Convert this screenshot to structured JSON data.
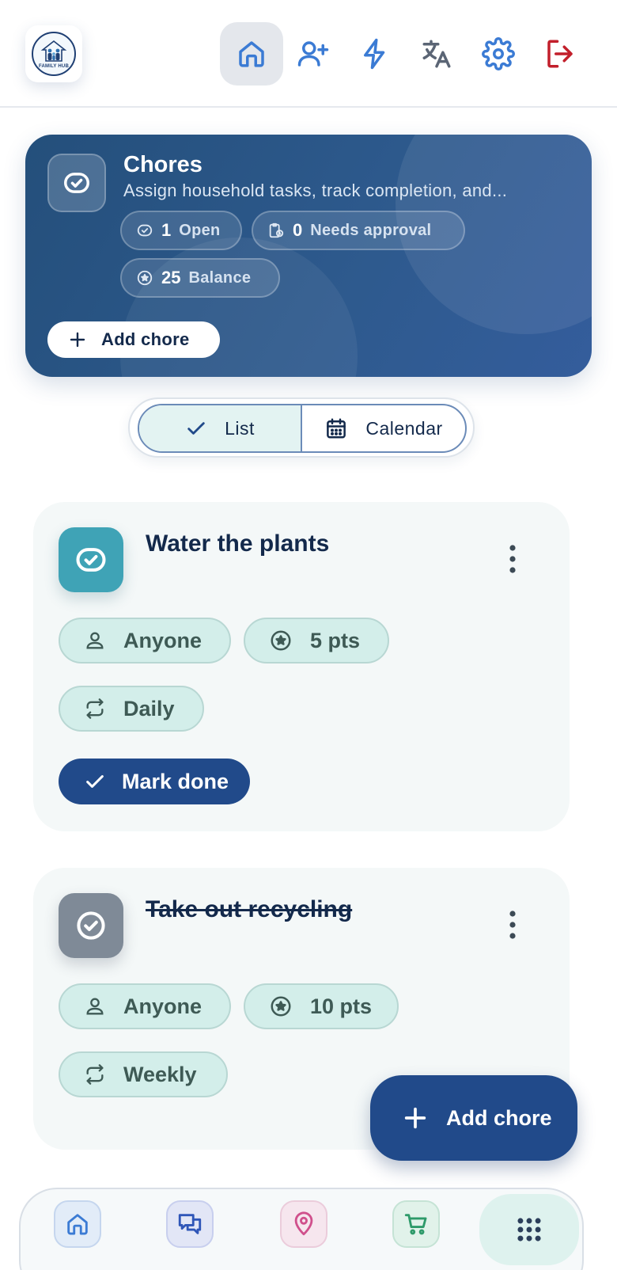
{
  "app": {
    "logo_text": "FAMILY HUB"
  },
  "topnav": {
    "icons": [
      "home-icon",
      "add-user-icon",
      "lightning-icon",
      "translate-icon",
      "gear-icon",
      "logout-icon"
    ],
    "active": "home-icon",
    "logout_color": "#c21f2b",
    "icon_color": "#3b7bd4"
  },
  "hero": {
    "title": "Chores",
    "subtitle": "Assign household tasks, track completion, and...",
    "stats": [
      {
        "value": "1",
        "label": "Open",
        "icon": "check-circle-icon"
      },
      {
        "value": "0",
        "label": "Needs approval",
        "icon": "clipboard-clock-icon"
      },
      {
        "value": "25",
        "label": "Balance",
        "icon": "star-circle-icon"
      }
    ],
    "add_label": "Add chore"
  },
  "view_toggle": {
    "options": [
      {
        "label": "List",
        "icon": "check-icon",
        "selected": true
      },
      {
        "label": "Calendar",
        "icon": "calendar-icon",
        "selected": false
      }
    ]
  },
  "chores": [
    {
      "title": "Water the plants",
      "completed": false,
      "assignee": "Anyone",
      "points": "5 pts",
      "recurrence": "Daily",
      "action_label": "Mark done",
      "icon_color": "#3fa3b6"
    },
    {
      "title": "Take out recycling",
      "completed": true,
      "assignee": "Anyone",
      "points": "10 pts",
      "recurrence": "Weekly",
      "icon_color": "#7f8a97"
    }
  ],
  "fab": {
    "label": "Add chore"
  },
  "bottom_nav": {
    "items": [
      "home-icon",
      "chat-icon",
      "location-pin-icon",
      "cart-icon",
      "apps-grid-icon"
    ],
    "active": "apps-grid-icon"
  }
}
